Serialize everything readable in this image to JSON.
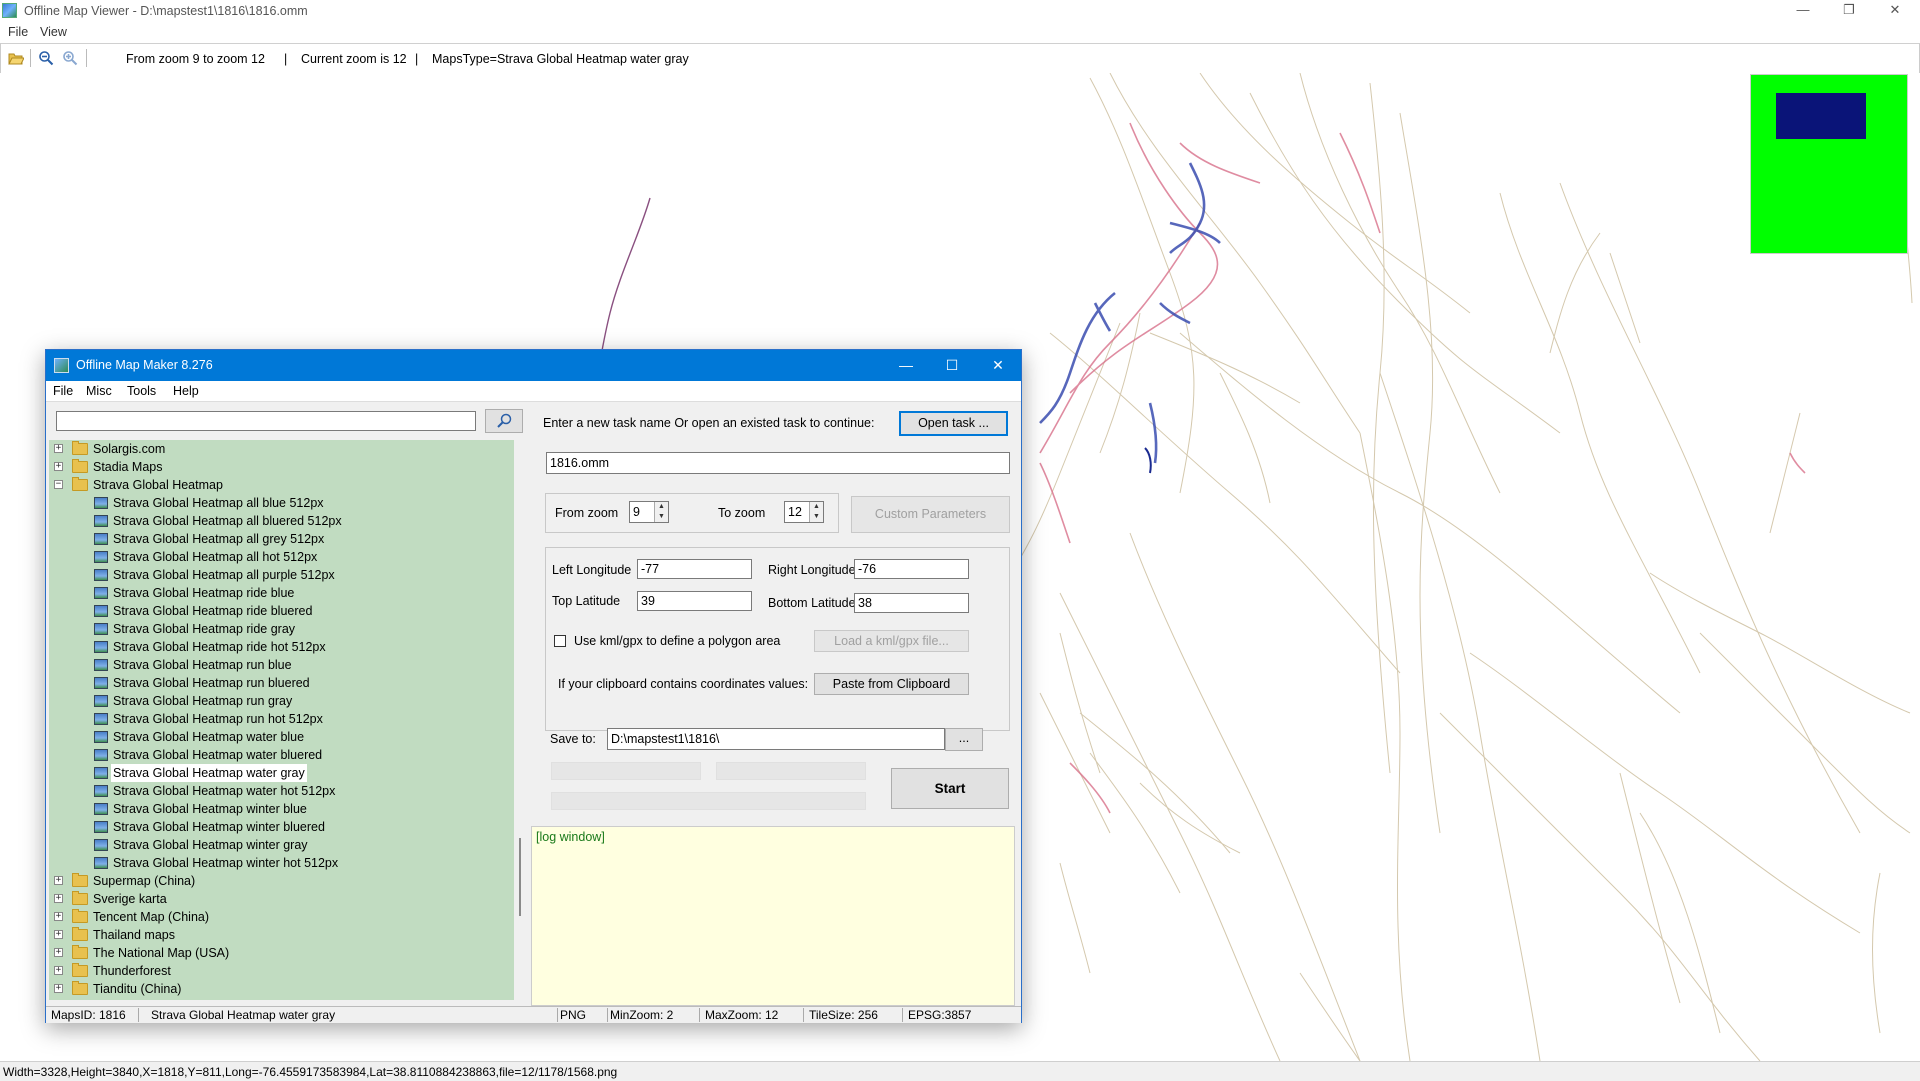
{
  "window": {
    "title": "Offline Map Viewer - D:\\mapstest1\\1816\\1816.omm",
    "controls": {
      "minimize": "—",
      "restore": "❐",
      "close": "✕"
    }
  },
  "menubar": {
    "file": "File",
    "view": "View"
  },
  "toolbar": {
    "zoom_range": "From zoom 9 to zoom 12",
    "current_zoom": "Current zoom is 12",
    "maps_type": "MapsType=Strava Global Heatmap water gray",
    "divider": "|"
  },
  "colors": {
    "minimap_bg": "#00ff00",
    "minimap_viewport": "#0a1478",
    "heat_line": "#c9b79a",
    "heat_hot": "#d8708a",
    "heat_core": "#3a4db0"
  },
  "statusbar": {
    "text": "Width=3328,Height=3840,X=1818,Y=811,Long=-76.4559173583984,Lat=38.8110884238863,file=12/1178/1568.png"
  },
  "dialog": {
    "title": "Offline Map Maker 8.276",
    "controls": {
      "minimize": "—",
      "maximize": "☐",
      "close": "✕"
    },
    "menu": {
      "file": "File",
      "misc": "Misc",
      "tools": "Tools",
      "help": "Help"
    },
    "search": {
      "value": "",
      "icon": "search-icon"
    },
    "tree": [
      {
        "label": "Solargis.com",
        "type": "folder",
        "expanded": false
      },
      {
        "label": "Stadia Maps",
        "type": "folder",
        "expanded": false
      },
      {
        "label": "Strava Global Heatmap",
        "type": "folder",
        "expanded": true
      },
      {
        "label": "Strava Global Heatmap all blue 512px",
        "type": "map"
      },
      {
        "label": "Strava Global Heatmap all bluered 512px",
        "type": "map"
      },
      {
        "label": "Strava Global Heatmap all grey 512px",
        "type": "map"
      },
      {
        "label": "Strava Global Heatmap all hot 512px",
        "type": "map"
      },
      {
        "label": "Strava Global Heatmap all purple 512px",
        "type": "map"
      },
      {
        "label": "Strava Global Heatmap ride blue",
        "type": "map"
      },
      {
        "label": "Strava Global Heatmap ride bluered",
        "type": "map"
      },
      {
        "label": "Strava Global Heatmap ride gray",
        "type": "map"
      },
      {
        "label": "Strava Global Heatmap ride hot 512px",
        "type": "map"
      },
      {
        "label": "Strava Global Heatmap run blue",
        "type": "map"
      },
      {
        "label": "Strava Global Heatmap run bluered",
        "type": "map"
      },
      {
        "label": "Strava Global Heatmap run gray",
        "type": "map"
      },
      {
        "label": "Strava Global Heatmap run hot 512px",
        "type": "map"
      },
      {
        "label": "Strava Global Heatmap water blue",
        "type": "map"
      },
      {
        "label": "Strava Global Heatmap water bluered",
        "type": "map"
      },
      {
        "label": "Strava Global Heatmap water gray",
        "type": "map",
        "selected": true
      },
      {
        "label": "Strava Global Heatmap water hot 512px",
        "type": "map"
      },
      {
        "label": "Strava Global Heatmap winter blue",
        "type": "map"
      },
      {
        "label": "Strava Global Heatmap winter bluered",
        "type": "map"
      },
      {
        "label": "Strava Global Heatmap winter gray",
        "type": "map"
      },
      {
        "label": "Strava Global Heatmap winter hot 512px",
        "type": "map"
      },
      {
        "label": "Supermap (China)",
        "type": "folder",
        "expanded": false
      },
      {
        "label": "Sverige karta",
        "type": "folder",
        "expanded": false
      },
      {
        "label": "Tencent Map (China)",
        "type": "folder",
        "expanded": false
      },
      {
        "label": "Thailand maps",
        "type": "folder",
        "expanded": false
      },
      {
        "label": "The National Map (USA)",
        "type": "folder",
        "expanded": false
      },
      {
        "label": "Thunderforest",
        "type": "folder",
        "expanded": false
      },
      {
        "label": "Tianditu (China)",
        "type": "folder",
        "expanded": false
      }
    ],
    "task": {
      "prompt": "Enter a new task name Or open an existed task to continue:",
      "open_button": "Open task ...",
      "name_value": "1816.omm"
    },
    "zoom": {
      "from_label": "From zoom",
      "from_value": "9",
      "to_label": "To zoom",
      "to_value": "12",
      "custom_button": "Custom Parameters"
    },
    "bounds": {
      "left_lon_label": "Left Longitude",
      "left_lon_value": "-77",
      "right_lon_label": "Right Longitude",
      "right_lon_value": "-76",
      "top_lat_label": "Top Latitude",
      "top_lat_value": "39",
      "bottom_lat_label": "Bottom Latitude",
      "bottom_lat_value": "38",
      "kml_checkbox_label": "Use kml/gpx to define a polygon area",
      "kml_checked": false,
      "load_kml_button": "Load a kml/gpx file...",
      "clipboard_label": "If your clipboard contains coordinates values:",
      "paste_button": "Paste from Clipboard"
    },
    "save": {
      "label": "Save to:",
      "value": "D:\\mapstest1\\1816\\",
      "browse_button": "..."
    },
    "start_button": "Start",
    "log": {
      "text": "[log window]"
    },
    "status": {
      "maps_id": "MapsID: 1816",
      "maps_name": "Strava Global Heatmap water gray",
      "format": "PNG",
      "min_zoom": "MinZoom: 2",
      "max_zoom": "MaxZoom: 12",
      "tile_size": "TileSize: 256",
      "epsg": "EPSG:3857"
    }
  }
}
